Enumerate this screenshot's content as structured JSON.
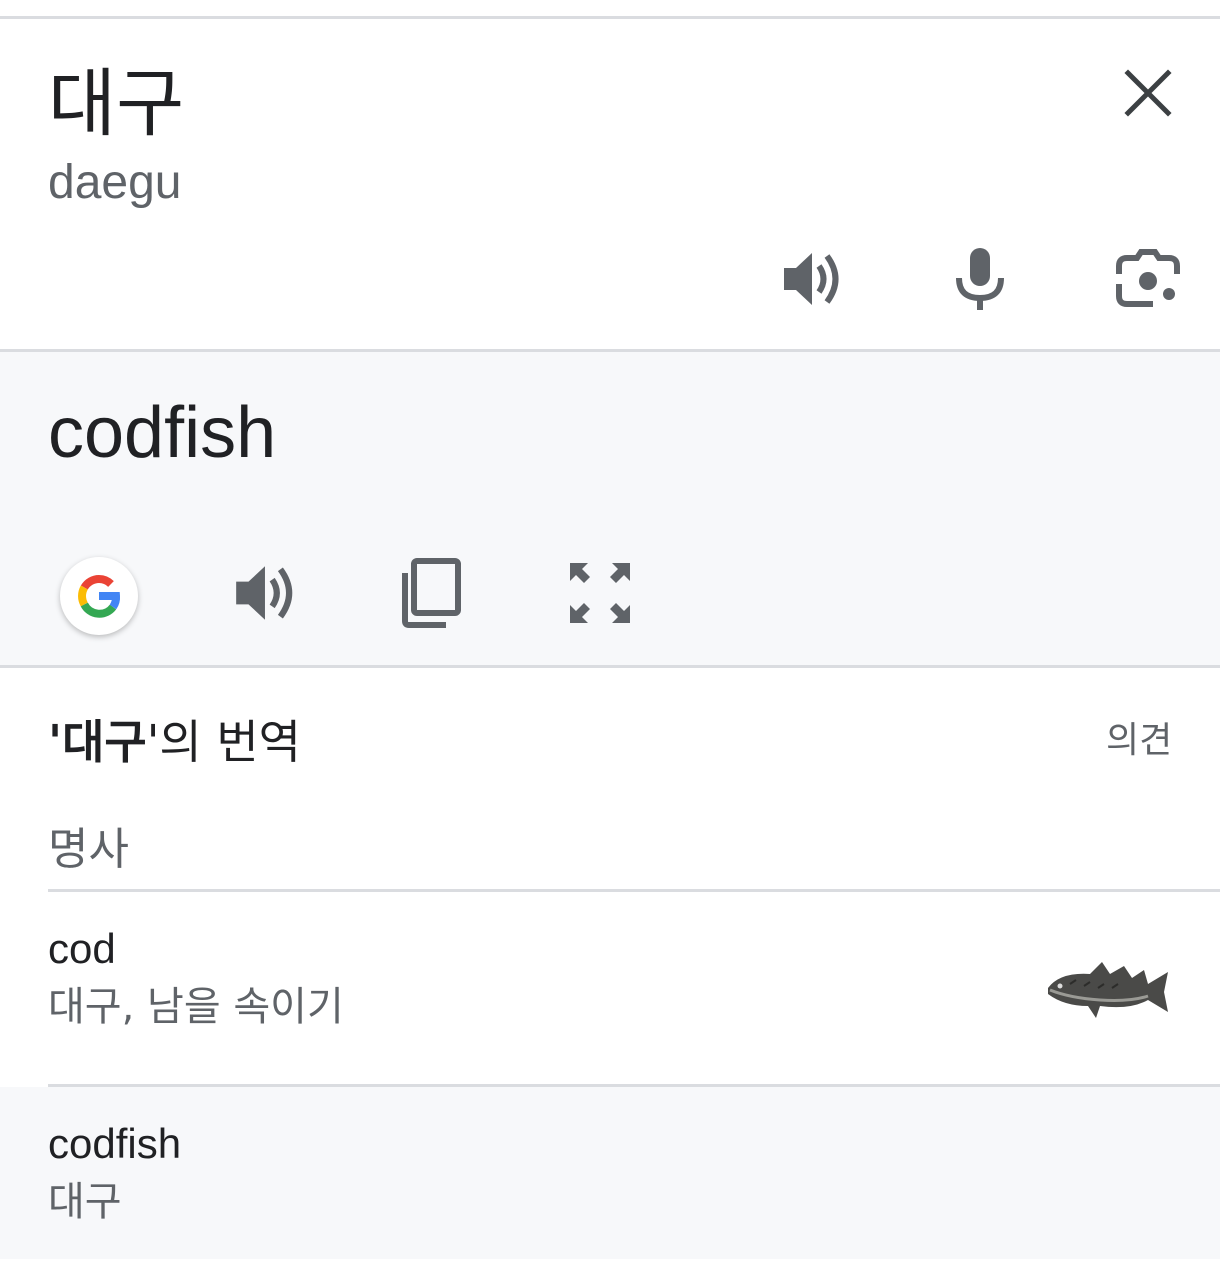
{
  "source": {
    "text": "대구",
    "transliteration": "daegu",
    "icons": [
      "close-icon",
      "speaker-icon",
      "microphone-icon",
      "camera-icon"
    ]
  },
  "translation": {
    "text": "codfish",
    "icons": [
      "google-icon",
      "speaker-icon",
      "copy-icon",
      "fullscreen-icon"
    ]
  },
  "dictionary": {
    "title_quote_open": "'",
    "title_word": "대구",
    "title_suffix": "'의 번역",
    "feedback_label": "의견",
    "part_of_speech": "명사",
    "entries": [
      {
        "word": "cod",
        "translations": "대구, 남을 속이기",
        "has_image": true
      },
      {
        "word": "codfish",
        "translations": "대구",
        "has_image": false
      }
    ]
  },
  "colors": {
    "text_primary": "#202124",
    "text_secondary": "#5f6368",
    "panel_gray": "#f7f8fa",
    "divider": "#dadce0",
    "icon_gray": "#5f6368"
  }
}
